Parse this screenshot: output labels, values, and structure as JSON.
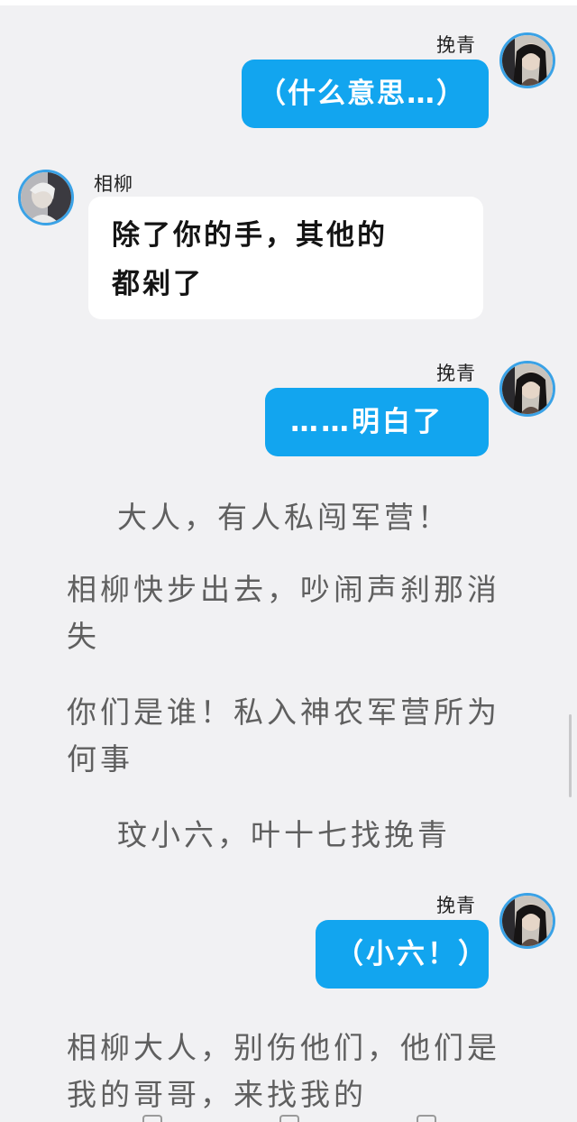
{
  "characters": {
    "self": {
      "name": "挽青",
      "avatar_icon": "portrait-woman-icon",
      "avatar_ring": "#3aa2e6"
    },
    "other": {
      "name": "相柳",
      "avatar_icon": "portrait-man-icon",
      "avatar_ring": "#3aa2e6"
    }
  },
  "colors": {
    "outgoing_bubble": "#12a5ef",
    "incoming_bubble": "#ffffff",
    "background": "#f1f1f3",
    "narration_text": "#5f5f5f"
  },
  "messages": [
    {
      "side": "right",
      "name": "挽青",
      "text": "（什么意思…）"
    },
    {
      "side": "left",
      "name": "相柳",
      "lines": [
        "除了你的手，其他的",
        "都剁了"
      ]
    },
    {
      "side": "right",
      "name": "挽青",
      "text": "……明白了"
    },
    {
      "side": "right",
      "name": "挽青",
      "text": "（小六！）"
    }
  ],
  "narration": [
    "大人，有人私闯军营！",
    "相柳快步出去，吵闹声刹那消失",
    "你们是谁！私入神农军营所为何事",
    "玟小六，叶十七找挽青",
    "相柳大人，别伤他们，他们是我的哥哥，来找我的"
  ]
}
